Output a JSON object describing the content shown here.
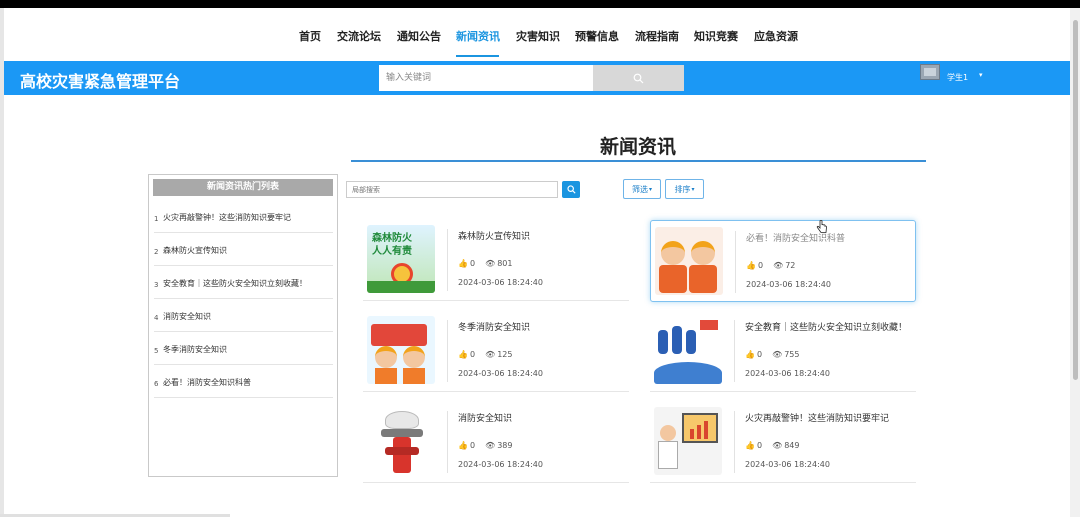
{
  "nav": [
    {
      "label": "首页",
      "active": false
    },
    {
      "label": "交流论坛",
      "active": false
    },
    {
      "label": "通知公告",
      "active": false
    },
    {
      "label": "新闻资讯",
      "active": true
    },
    {
      "label": "灾害知识",
      "active": false
    },
    {
      "label": "预警信息",
      "active": false
    },
    {
      "label": "流程指南",
      "active": false
    },
    {
      "label": "知识竞赛",
      "active": false
    },
    {
      "label": "应急资源",
      "active": false
    }
  ],
  "header": {
    "site_title": "高校灾害紧急管理平台",
    "search_placeholder": "输入关键词",
    "username": "学生1"
  },
  "page_title": "新闻资讯",
  "sidebar": {
    "heading": "新闻资讯热门列表",
    "items": [
      {
        "num": "1",
        "title": "火灾再敲警钟！这些消防知识要牢记"
      },
      {
        "num": "2",
        "title": "森林防火宣传知识"
      },
      {
        "num": "3",
        "title": "安全教育｜这些防火安全知识立刻收藏！"
      },
      {
        "num": "4",
        "title": "消防安全知识"
      },
      {
        "num": "5",
        "title": "冬季消防安全知识"
      },
      {
        "num": "6",
        "title": "必看！消防安全知识科普"
      }
    ]
  },
  "filter": {
    "placeholder": "局部搜索",
    "filter_label": "筛选",
    "sort_label": "排序"
  },
  "thumb_text": {
    "forest_line1": "森林防火",
    "forest_line2": "人人有责"
  },
  "cards": [
    {
      "title": "森林防火宣传知识",
      "likes": "0",
      "views": "801",
      "date": "2024-03-06 18:24:40",
      "thumb": "forest-fire-thumb"
    },
    {
      "title": "必看！消防安全知识科普",
      "likes": "0",
      "views": "72",
      "date": "2024-03-06 18:24:40",
      "thumb": "firefighters-thumb"
    },
    {
      "title": "冬季消防安全知识",
      "likes": "0",
      "views": "125",
      "date": "2024-03-06 18:24:40",
      "thumb": "firetruck-kids-thumb"
    },
    {
      "title": "安全教育｜这些防火安全知识立刻收藏！",
      "likes": "0",
      "views": "755",
      "date": "2024-03-06 18:24:40",
      "thumb": "safety-education-thumb"
    },
    {
      "title": "消防安全知识",
      "likes": "0",
      "views": "389",
      "date": "2024-03-06 18:24:40",
      "thumb": "hydrant-thumb"
    },
    {
      "title": "火灾再敲警钟！这些消防知识要牢记",
      "likes": "0",
      "views": "849",
      "date": "2024-03-06 18:24:40",
      "thumb": "presentation-thumb"
    }
  ],
  "colors": {
    "accent": "#1b95e0",
    "header_bar": "#1b98f5"
  }
}
